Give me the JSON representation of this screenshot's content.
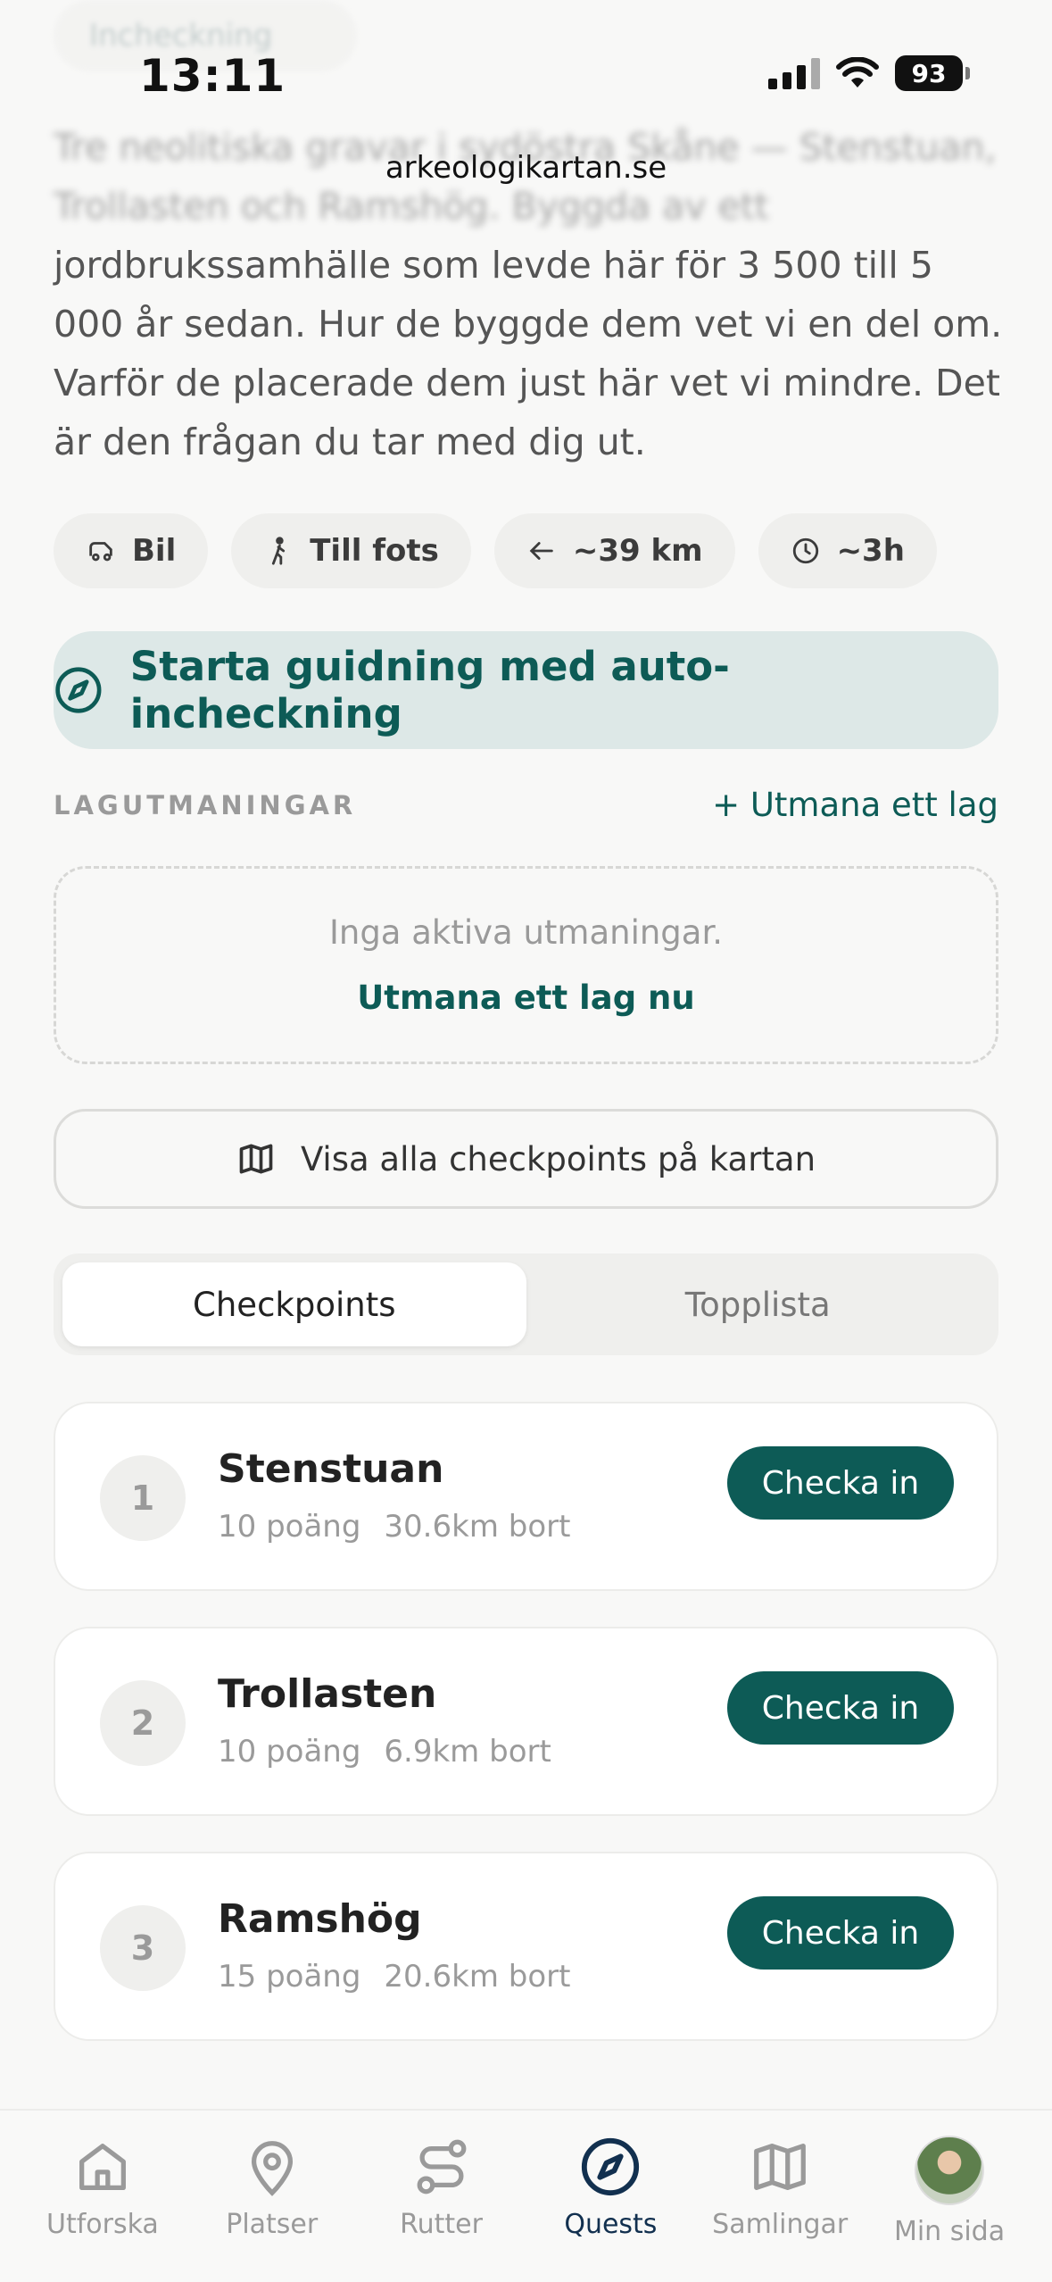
{
  "status_bar": {
    "time": "13:11",
    "battery": "93"
  },
  "ghost_chip": "Incheckning",
  "url": "arkeologikartan.se",
  "intro": {
    "blurred_text": "Tre neolitiska gravar i sydöstra Skåne — Stenstuan, Trollasten och Ramshög. Byggda av ett",
    "text": "jordbrukssamhälle som levde här för 3 500 till 5 000 år sedan. Hur de byggde dem vet vi en del om. Varför de placerade dem just här vet vi mindre. Det är den frågan du tar med dig ut."
  },
  "chips": [
    {
      "label": "Bil",
      "icon": "car-icon"
    },
    {
      "label": "Till fots",
      "icon": "walk-icon"
    },
    {
      "label": "~39 km",
      "icon": "arrow-icon"
    },
    {
      "label": "~3h",
      "icon": "clock-icon"
    }
  ],
  "start_button": {
    "label": "Starta guidning med auto-incheckning",
    "icon": "compass-icon"
  },
  "challenges": {
    "section_label": "LAGUTMANINGAR",
    "link": "+ Utmana ett lag",
    "empty_text": "Inga aktiva utmaningar.",
    "empty_link": "Utmana ett lag nu"
  },
  "map_button": {
    "label": "Visa alla checkpoints på kartan",
    "icon": "map-icon"
  },
  "segment": {
    "tabs": [
      "Checkpoints",
      "Topplista"
    ],
    "active": "Checkpoints"
  },
  "checkpoints": [
    {
      "number": "1",
      "name": "Stenstuan",
      "points": "10 poäng",
      "distance": "30.6km bort",
      "button": "Checka in"
    },
    {
      "number": "2",
      "name": "Trollasten",
      "points": "10 poäng",
      "distance": "6.9km bort",
      "button": "Checka in"
    },
    {
      "number": "3",
      "name": "Ramshög",
      "points": "15 poäng",
      "distance": "20.6km bort",
      "button": "Checka in"
    }
  ],
  "tabbar": [
    {
      "label": "Utforska",
      "icon": "home-icon"
    },
    {
      "label": "Platser",
      "icon": "pin-icon"
    },
    {
      "label": "Rutter",
      "icon": "route-icon"
    },
    {
      "label": "Quests",
      "icon": "compass-icon",
      "active": true
    },
    {
      "label": "Samlingar",
      "icon": "map-icon"
    },
    {
      "label": "Min sida",
      "icon": "avatar"
    }
  ],
  "colors": {
    "accent": "#0d5b56",
    "accent_light": "#dde8e7",
    "active_tab": "#12304f",
    "background": "#f8f8f7"
  }
}
